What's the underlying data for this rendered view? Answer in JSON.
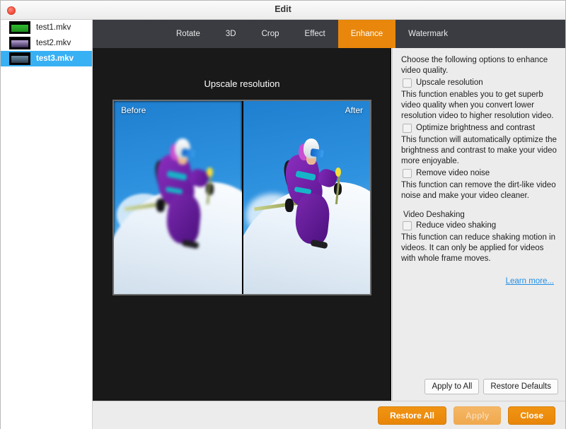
{
  "window": {
    "title": "Edit",
    "close_icon": "close-dot-icon"
  },
  "sidebar": {
    "files": [
      {
        "name": "test1.mkv",
        "selected": false
      },
      {
        "name": "test2.mkv",
        "selected": false
      },
      {
        "name": "test3.mkv",
        "selected": true
      }
    ]
  },
  "tabs": [
    {
      "label": "Rotate",
      "active": false
    },
    {
      "label": "3D",
      "active": false
    },
    {
      "label": "Crop",
      "active": false
    },
    {
      "label": "Effect",
      "active": false
    },
    {
      "label": "Enhance",
      "active": true
    },
    {
      "label": "Watermark",
      "active": false
    }
  ],
  "preview": {
    "heading": "Upscale resolution",
    "before_label": "Before",
    "after_label": "After"
  },
  "options": {
    "intro": "Choose the following options to enhance video quality.",
    "items": [
      {
        "checkbox_label": "Upscale resolution",
        "checked": false,
        "description": "This function enables you to get superb video quality when you convert lower resolution video to higher resolution video."
      },
      {
        "checkbox_label": "Optimize brightness and contrast",
        "checked": false,
        "description": "This function will automatically optimize the brightness and contrast to make your video more enjoyable."
      },
      {
        "checkbox_label": "Remove video noise",
        "checked": false,
        "description": "This function can remove the dirt-like video noise and make your video cleaner."
      }
    ],
    "section_label": "Video Deshaking",
    "deshake": {
      "checkbox_label": "Reduce video shaking",
      "checked": false,
      "description": "This function can reduce shaking motion in videos. It can only be applied for videos with whole frame moves."
    },
    "learn_more": "Learn more...",
    "apply_to_all": "Apply to All",
    "restore_defaults": "Restore Defaults"
  },
  "footer": {
    "restore_all": "Restore All",
    "apply": "Apply",
    "apply_disabled": true,
    "close": "Close"
  },
  "colors": {
    "accent_orange": "#e8870b",
    "selection_blue": "#38b0f4",
    "link_blue": "#1f8fe8",
    "tabbar_dark": "#3a3c42",
    "preview_dark": "#191919"
  }
}
